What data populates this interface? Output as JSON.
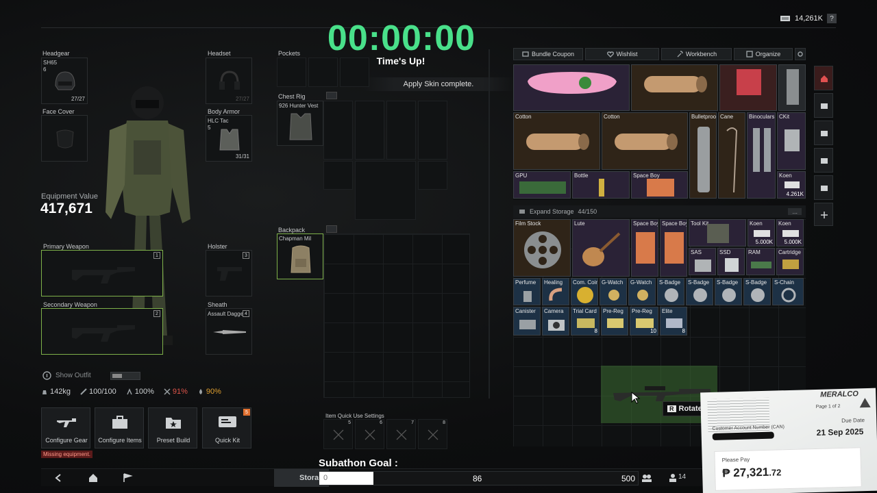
{
  "overlay": {
    "timer": "00:00:00",
    "timer_subtitle": "Time's Up!",
    "toast": "Apply Skin complete.",
    "subathon_label": "Subathon Goal :",
    "subathon_min": "0",
    "subathon_current": "86",
    "subathon_max": "500",
    "subathon_progress": 0.17
  },
  "currency": {
    "amount": "14,261K",
    "help": "?"
  },
  "gear": {
    "headgear": {
      "label": "Headgear",
      "name": "SH65",
      "level": "6",
      "durability": "27/27"
    },
    "headset": {
      "label": "Headset",
      "durability": "27/27"
    },
    "face_cover": {
      "label": "Face Cover"
    },
    "body_armor": {
      "label": "Body Armor",
      "name": "HLC Tac",
      "level": "5",
      "durability": "31/31"
    },
    "primary": {
      "label": "Primary Weapon",
      "index": "1"
    },
    "secondary": {
      "label": "Secondary Weapon",
      "index": "2"
    },
    "holster": {
      "label": "Holster",
      "index": "3"
    },
    "sheath": {
      "label": "Sheath",
      "name": "Assault Dagger",
      "index": "4"
    },
    "equipment_value_label": "Equipment Value",
    "equipment_value": "417,671",
    "show_outfit": "Show Outfit"
  },
  "stats": {
    "weight": "142kg",
    "health": "100/100",
    "stamina": "100%",
    "hunger": "91%",
    "hydration": "90%"
  },
  "actions": [
    {
      "label": "Configure Gear"
    },
    {
      "label": "Configure Items"
    },
    {
      "label": "Preset Build"
    },
    {
      "label": "Quick Kit",
      "badge": "5"
    }
  ],
  "warning": "Missing equipment.",
  "containers": {
    "pockets": "Pockets",
    "chest_rig": "Chest Rig",
    "chest_rig_item": "926 Hunter Vest",
    "backpack": "Backpack",
    "backpack_item": "Chapman Mil",
    "quick_use": "Item Quick Use Settings",
    "quick_slots": [
      "5",
      "6",
      "7",
      "8"
    ]
  },
  "tabs": [
    {
      "label": "Bundle Coupon"
    },
    {
      "label": "Wishlist"
    },
    {
      "label": "Workbench"
    },
    {
      "label": "Organize"
    }
  ],
  "storage": {
    "expand_label": "Expand Storage",
    "count": "44/150",
    "more": "..."
  },
  "top_items": [
    {
      "name": "Cotton"
    },
    {
      "name": "Cotton"
    },
    {
      "name": "Bulletproo"
    },
    {
      "name": "Cane"
    },
    {
      "name": "Binoculars"
    },
    {
      "name": "CKit"
    },
    {
      "name": "GPU"
    },
    {
      "name": "Bottle"
    },
    {
      "name": "Space Boy"
    },
    {
      "name": "Koen",
      "qty": "4.261K"
    }
  ],
  "items": [
    {
      "name": "Film Stock"
    },
    {
      "name": "Lute"
    },
    {
      "name": "Space Boy"
    },
    {
      "name": "Space Boy"
    },
    {
      "name": "Tool Kit"
    },
    {
      "name": "Koen",
      "qty": "5.000K"
    },
    {
      "name": "Koen",
      "qty": "5.000K"
    },
    {
      "name": "SAS"
    },
    {
      "name": "SSD"
    },
    {
      "name": "RAM"
    },
    {
      "name": "Cartridge"
    },
    {
      "name": "Perfume"
    },
    {
      "name": "Healing"
    },
    {
      "name": "Com. Coin"
    },
    {
      "name": "G-Watch"
    },
    {
      "name": "G-Watch"
    },
    {
      "name": "S-Badge"
    },
    {
      "name": "S-Badge"
    },
    {
      "name": "S-Badge"
    },
    {
      "name": "S-Badge"
    },
    {
      "name": "S-Chain"
    },
    {
      "name": "Canister"
    },
    {
      "name": "Camera"
    },
    {
      "name": "Trial Card",
      "qty": "8"
    },
    {
      "name": "Pre-Reg"
    },
    {
      "name": "Pre-Reg",
      "qty": "10"
    },
    {
      "name": "Elite",
      "qty": "8"
    }
  ],
  "rotate": {
    "key": "R",
    "label": "Rotate"
  },
  "bottom_bar": {
    "storage_tab": "Storage",
    "friends": "14"
  },
  "bill": {
    "company": "MERALCO",
    "page": "Page 1 of 2",
    "account_label": "Customer Account Number (CAN)",
    "due_label": "Due Date",
    "due_date": "21 Sep 2025",
    "pay_label": "Please Pay",
    "amount_main": "₱ 27,321",
    "amount_cents": ".72"
  },
  "colors": {
    "accent_green": "#49e08a",
    "select_green": "#7fb24a",
    "warning_red": "#e0544a",
    "hunger_red": "#e0544a",
    "hydration_orange": "#e0a030"
  }
}
